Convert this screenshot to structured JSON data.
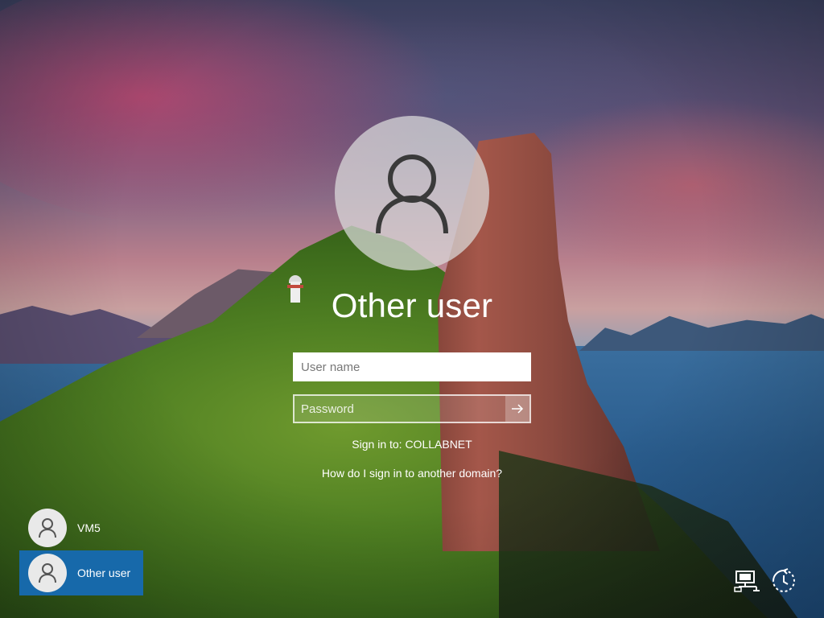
{
  "login": {
    "account_title": "Other user",
    "username_placeholder": "User name",
    "password_placeholder": "Password",
    "sign_in_to": "Sign in to: COLLABNET",
    "help_link": "How do I sign in to another domain?"
  },
  "users": [
    {
      "name": "VM5",
      "selected": false
    },
    {
      "name": "Other user",
      "selected": true
    }
  ],
  "system_icons": [
    "network-icon",
    "ease-of-access-icon"
  ],
  "colors": {
    "selected_tile": "#1769aa",
    "field_border": "#ffffff"
  }
}
